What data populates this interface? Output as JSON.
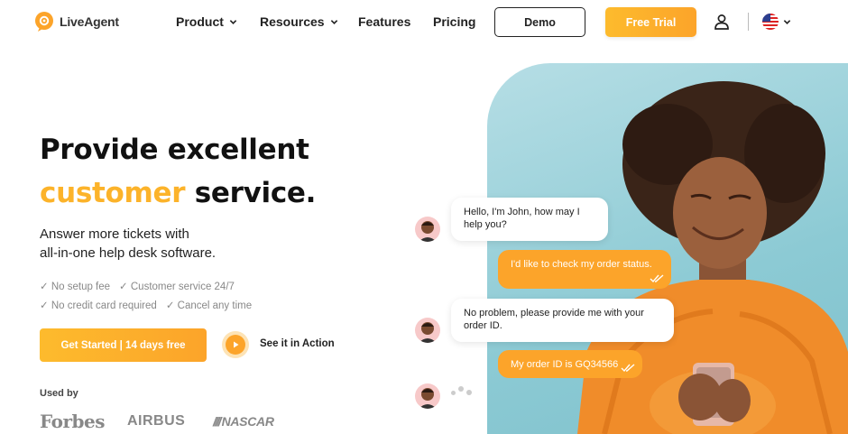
{
  "brand": {
    "name": "LiveAgent",
    "accent": "#fcb32a"
  },
  "nav": {
    "items": [
      {
        "label": "Product",
        "dropdown": true
      },
      {
        "label": "Resources",
        "dropdown": true
      },
      {
        "label": "Features",
        "dropdown": false
      },
      {
        "label": "Pricing",
        "dropdown": false
      }
    ],
    "demo_label": "Demo",
    "trial_label": "Free Trial",
    "user_icon": "user-icon",
    "language_icon": "us-flag-icon"
  },
  "hero": {
    "title_line1": "Provide excellent",
    "title_accent": "customer",
    "title_rest": " service.",
    "subtitle_line1": "Answer more tickets with",
    "subtitle_line2": "all-in-one help desk software.",
    "features": [
      "✓ No setup fee",
      "✓ Customer service 24/7",
      "✓ No credit card required",
      "✓ Cancel any time"
    ],
    "cta_label": "Get Started | 14 days free",
    "action_label": "See it in Action",
    "used_by_label": "Used by",
    "logos": [
      "Forbes",
      "AIRBUS",
      "NASCAR"
    ]
  },
  "chat": {
    "messages": [
      {
        "from": "agent",
        "text": "Hello, I'm John, how may I help you?"
      },
      {
        "from": "customer",
        "text": "I'd like to check my order status."
      },
      {
        "from": "agent",
        "text": "No problem, please provide me with your order ID."
      },
      {
        "from": "customer",
        "text": "My order ID is GQ34566"
      }
    ]
  }
}
